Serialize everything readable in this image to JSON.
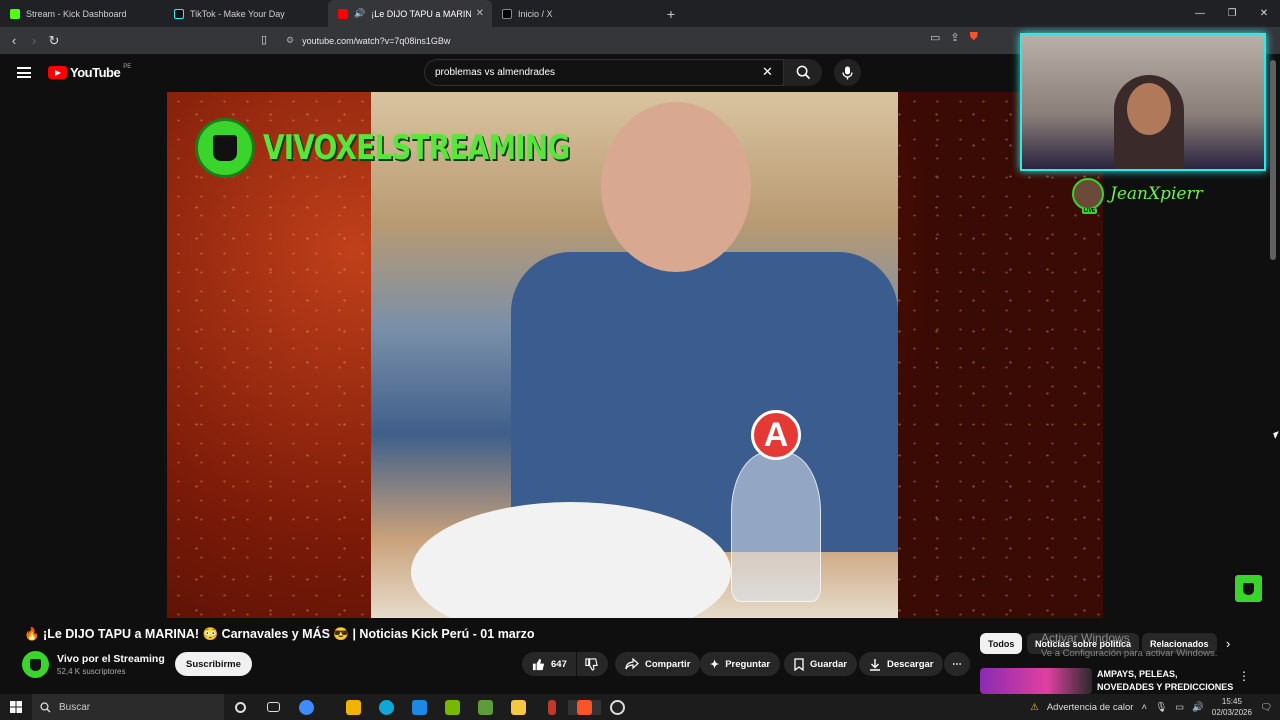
{
  "browser": {
    "tabs": [
      {
        "label": "Stream - Kick Dashboard",
        "color": "#53fc18"
      },
      {
        "label": "TikTok - Make Your Day",
        "color": "#111111"
      },
      {
        "label": "¡Le DIJO TAPU a MARINA!",
        "color": "#ff0000",
        "active": true
      },
      {
        "label": "Inicio / X",
        "color": "#000000"
      }
    ],
    "url": "youtube.com/watch?v=7q08ins1GBw"
  },
  "youtube": {
    "logo_text": "YouTube",
    "country_code": "PE",
    "search_value": "problemas vs almendrades"
  },
  "video": {
    "watermark_channel": "VIVOXELSTREAMING",
    "plate_letter": "A",
    "streamer_name": "JeanXpierr",
    "streamer_live_badge": "LIVE"
  },
  "watch": {
    "title": "🔥 ¡Le DIJO TAPU a MARINA! 😳 Carnavales y MÁS 😎 | Noticias Kick Perú - 01 marzo",
    "channel_name": "Vivo por el Streaming",
    "subscribers": "52,4 K suscriptores",
    "subscribe_label": "Suscribirme",
    "like_count": "647",
    "share_label": "Compartir",
    "ask_label": "Preguntar",
    "save_label": "Guardar",
    "download_label": "Descargar"
  },
  "sidebar": {
    "chips": [
      "Todos",
      "Noticias sobre política",
      "Relacionados"
    ],
    "activation_title": "Activar Windows",
    "activation_sub": "Ve a Configuración para activar Windows.",
    "suggestion_title": "AMPAYS, PELEAS, NOVEDADES Y PREDICCIONES DEL FUTUR..."
  },
  "taskbar": {
    "search_placeholder": "Buscar",
    "weather": "Advertencia de calor",
    "time": "15:45",
    "date": "02/03/2026"
  }
}
